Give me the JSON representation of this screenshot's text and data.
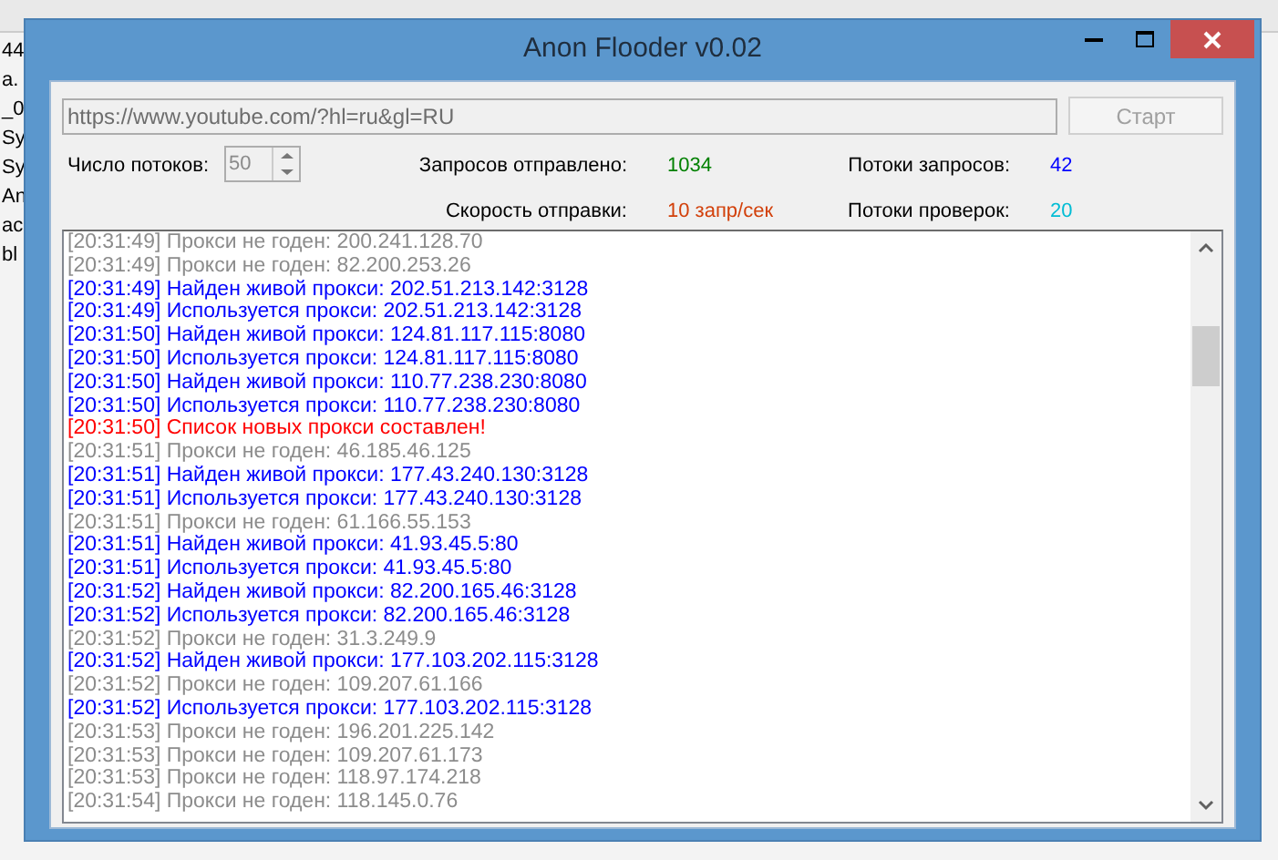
{
  "background_fragments": [
    "44",
    "a.",
    "_0",
    "Sy",
    "Sy",
    "An",
    "ac",
    "bl"
  ],
  "window": {
    "title": "Anon Flooder v0.02"
  },
  "url_field": {
    "value": "https://www.youtube.com/?hl=ru&gl=RU",
    "disabled": true
  },
  "start_button": {
    "label": "Старт",
    "disabled": true
  },
  "threads": {
    "label": "Число потоков:",
    "value": "50",
    "disabled": true
  },
  "stats": [
    {
      "label": "Запросов отправлено:",
      "value": "1034",
      "color": "#008000"
    },
    {
      "label": "Скорость отправки:",
      "value": "10 запр/сек",
      "color": "#d2400a"
    },
    {
      "label": "Потоки запросов:",
      "value": "42",
      "color": "#0000ff"
    },
    {
      "label": "Потоки проверок:",
      "value": "20",
      "color": "#00bcd4"
    }
  ],
  "log": [
    {
      "kind": "bad",
      "text": "[20:31:49] Прокси не годен: 200.241.128.70"
    },
    {
      "kind": "bad",
      "text": "[20:31:49] Прокси не годен: 82.200.253.26"
    },
    {
      "kind": "good",
      "text": "[20:31:49] Найден живой прокси: 202.51.213.142:3128"
    },
    {
      "kind": "good",
      "text": "[20:31:49] Используется прокси: 202.51.213.142:3128"
    },
    {
      "kind": "good",
      "text": "[20:31:50] Найден живой прокси: 124.81.117.115:8080"
    },
    {
      "kind": "good",
      "text": "[20:31:50] Используется прокси: 124.81.117.115:8080"
    },
    {
      "kind": "good",
      "text": "[20:31:50] Найден живой прокси: 110.77.238.230:8080"
    },
    {
      "kind": "good",
      "text": "[20:31:50] Используется прокси: 110.77.238.230:8080"
    },
    {
      "kind": "info",
      "text": "[20:31:50] Список новых прокси составлен!"
    },
    {
      "kind": "bad",
      "text": "[20:31:51] Прокси не годен: 46.185.46.125"
    },
    {
      "kind": "good",
      "text": "[20:31:51] Найден живой прокси: 177.43.240.130:3128"
    },
    {
      "kind": "good",
      "text": "[20:31:51] Используется прокси: 177.43.240.130:3128"
    },
    {
      "kind": "bad",
      "text": "[20:31:51] Прокси не годен: 61.166.55.153"
    },
    {
      "kind": "good",
      "text": "[20:31:51] Найден живой прокси: 41.93.45.5:80"
    },
    {
      "kind": "good",
      "text": "[20:31:51] Используется прокси: 41.93.45.5:80"
    },
    {
      "kind": "good",
      "text": "[20:31:52] Найден живой прокси: 82.200.165.46:3128"
    },
    {
      "kind": "good",
      "text": "[20:31:52] Используется прокси: 82.200.165.46:3128"
    },
    {
      "kind": "bad",
      "text": "[20:31:52] Прокси не годен: 31.3.249.9"
    },
    {
      "kind": "good",
      "text": "[20:31:52] Найден живой прокси: 177.103.202.115:3128"
    },
    {
      "kind": "bad",
      "text": "[20:31:52] Прокси не годен: 109.207.61.166"
    },
    {
      "kind": "good",
      "text": "[20:31:52] Используется прокси: 177.103.202.115:3128"
    },
    {
      "kind": "bad",
      "text": "[20:31:53] Прокси не годен: 196.201.225.142"
    },
    {
      "kind": "bad",
      "text": "[20:31:53] Прокси не годен: 109.207.61.173"
    },
    {
      "kind": "bad",
      "text": "[20:31:53] Прокси не годен: 118.97.174.218"
    },
    {
      "kind": "bad",
      "text": "[20:31:54] Прокси не годен: 118.145.0.76"
    }
  ]
}
